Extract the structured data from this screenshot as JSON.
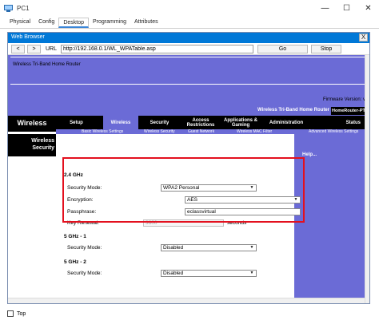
{
  "window": {
    "title": "PC1",
    "minimize": "—",
    "maximize": "☐",
    "close": "✕"
  },
  "tabs": [
    {
      "label": "Physical",
      "active": false
    },
    {
      "label": "Config",
      "active": false
    },
    {
      "label": "Desktop",
      "active": true
    },
    {
      "label": "Programming",
      "active": false
    },
    {
      "label": "Attributes",
      "active": false
    }
  ],
  "browser": {
    "title": "Web Browser",
    "close": "X",
    "back": "<",
    "forward": ">",
    "url_label": "URL",
    "url": "http://192.168.0.1/WL_WPATable.asp",
    "go": "Go",
    "stop": "Stop"
  },
  "router": {
    "brand": "Wireless Tri-Band Home Router",
    "firmware": "Firmware Version: v",
    "model_name": "Wireless Tri-Band Home Router",
    "model_id": "HomeRouter-PT-",
    "section": "Wireless",
    "menu": [
      "Setup",
      "Wireless",
      "Security",
      "Access Restrictions",
      "Applications & Gaming",
      "Administration",
      "Status"
    ],
    "submenu": [
      "Basic Wireless Settings",
      "Wireless Security",
      "Guest Network",
      "Wireless MAC Filter",
      "Advanced Wireless Settings"
    ],
    "left_title": "Wireless Security",
    "help": "Help...",
    "band24": {
      "title": "2.4 GHz",
      "security_mode_label": "Security Mode:",
      "security_mode": "WPA2 Personal",
      "encryption_label": "Encryption:",
      "encryption": "AES",
      "passphrase_label": "Passphrase:",
      "passphrase": "eclassvirtual",
      "key_renewal_label": "Key Renewal:",
      "key_renewal": "3600",
      "key_renewal_unit": "seconds"
    },
    "band5_1": {
      "title": "5 GHz - 1",
      "security_mode_label": "Security Mode:",
      "security_mode": "Disabled"
    },
    "band5_2": {
      "title": "5 GHz - 2",
      "security_mode_label": "Security Mode:",
      "security_mode": "Disabled"
    }
  },
  "footer": {
    "top_label": "Top"
  },
  "colors": {
    "router_accent": "#6b6bd6",
    "highlight": "#e3101e",
    "titlebar_blue": "#0078d7"
  }
}
